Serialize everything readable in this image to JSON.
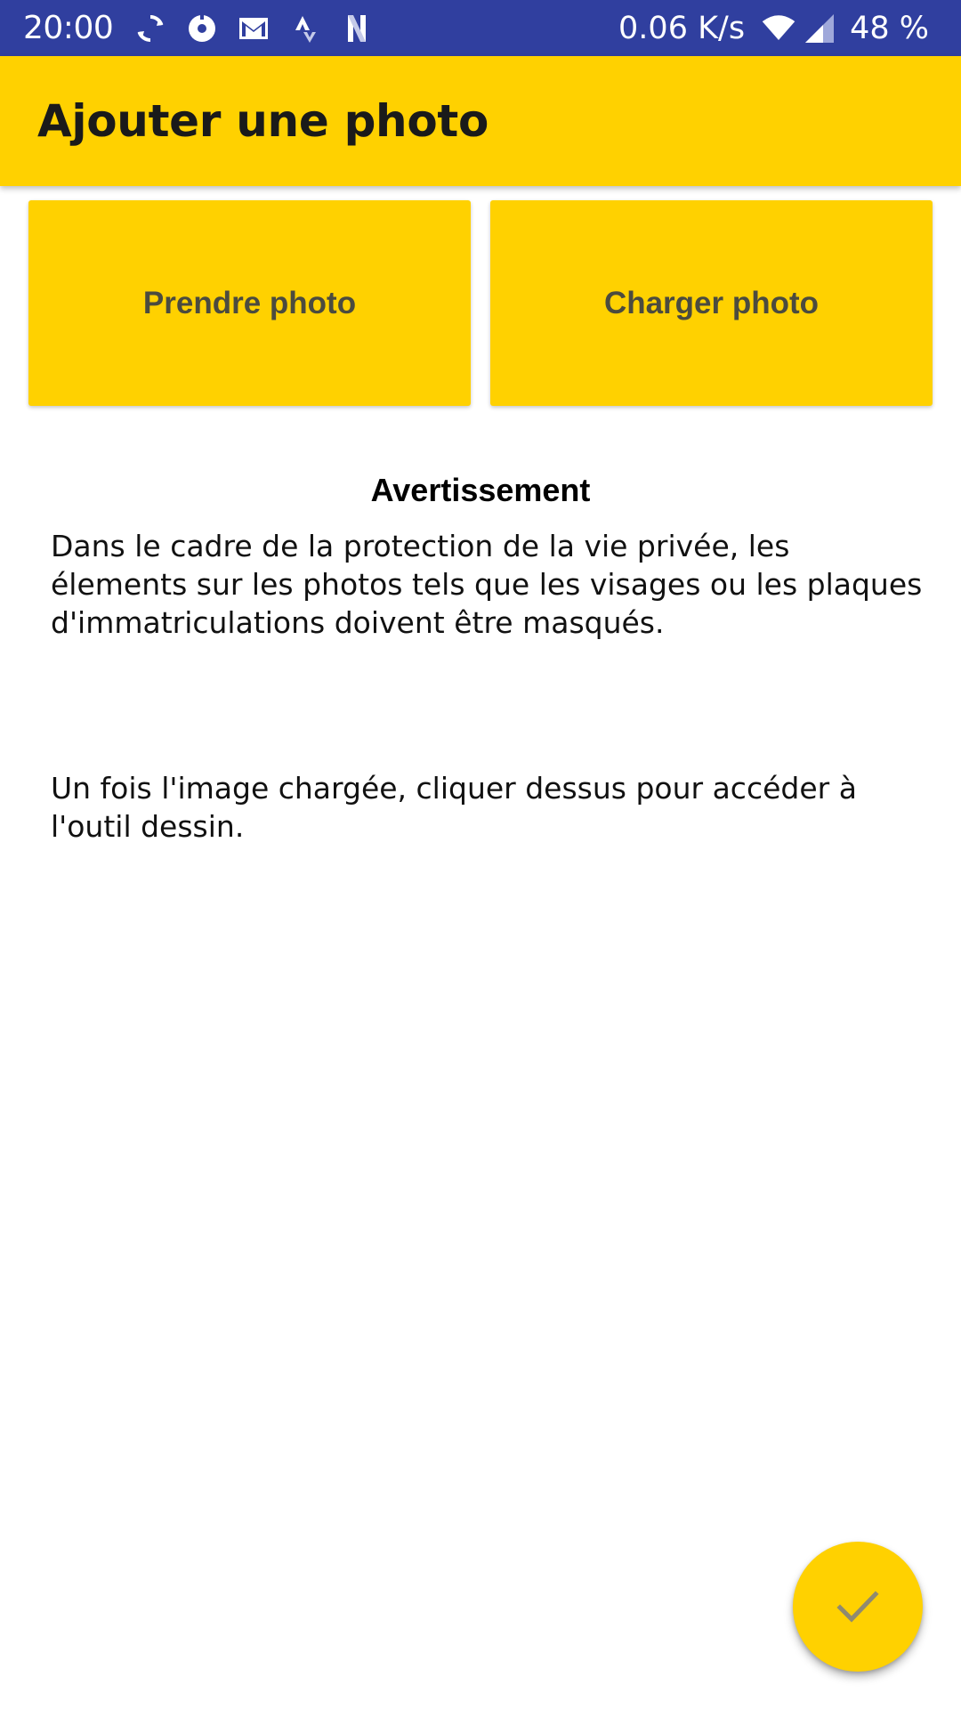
{
  "status_bar": {
    "time": "20:00",
    "icons": [
      "sync-icon",
      "record-icon",
      "gmail-icon",
      "strava-icon",
      "netflix-icon"
    ],
    "net_speed": "0.06 K/s",
    "wifi_icon": "wifi-icon",
    "signal_icon": "signal-icon",
    "battery": "48 %"
  },
  "app_bar": {
    "title": "Ajouter une photo"
  },
  "actions": {
    "take_photo_label": "Prendre photo",
    "load_photo_label": "Charger photo"
  },
  "warning": {
    "title": "Avertissement",
    "paragraph_1": "Dans le cadre de la protection de la vie privée, les élements sur les photos tels que les visages ou les plaques d'immatriculations doivent être masqués.",
    "paragraph_2": "Un fois l'image chargée, cliquer dessus pour accéder à l'outil dessin."
  },
  "fab": {
    "icon": "check-icon"
  },
  "colors": {
    "status_bar": "#303F9F",
    "accent": "#FFD100",
    "button_text": "#4b4b3f"
  }
}
